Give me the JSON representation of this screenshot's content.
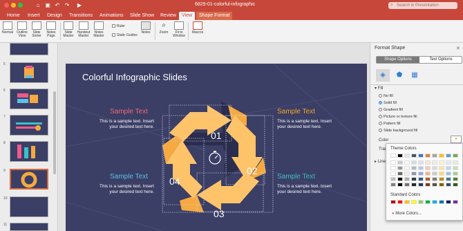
{
  "app": {
    "doc_title": "6829-01-colorful-infographic",
    "search_placeholder": "Search in Presentation"
  },
  "tabs": [
    "Home",
    "Insert",
    "Design",
    "Transitions",
    "Animations",
    "Slide Show",
    "Review",
    "View",
    "Shape Format"
  ],
  "ribbon": {
    "buttons": [
      "Normal",
      "Outline View",
      "Slide Sorter",
      "Notes Page",
      "Slide Master",
      "Handout Master",
      "Notes Master",
      "Notes",
      "Zoom",
      "Fit to Window",
      "Macros"
    ],
    "checks": [
      "Ruler",
      "Static Guides"
    ]
  },
  "thumbs": {
    "numbers": [
      "5",
      "6",
      "7",
      "8",
      "9",
      "10",
      "11"
    ]
  },
  "slide": {
    "title": "Colorful Infographic Slides",
    "numbers": [
      "01",
      "02",
      "03",
      "04"
    ],
    "items": [
      {
        "title": "Sample Text",
        "body": "This is a sample text. Insert your desired text here.",
        "color": "#f16a7a"
      },
      {
        "title": "Sample Text",
        "body": "This is a sample text. Insert your desired text here.",
        "color": "#f3a72e"
      },
      {
        "title": "Sample Text",
        "body": "This is a sample text. Insert your desired text here.",
        "color": "#5cc0e8"
      },
      {
        "title": "Sample Text",
        "body": "This is a sample text. Insert your desired text here.",
        "color": "#39c1c8"
      }
    ]
  },
  "pane": {
    "title": "Format Shape",
    "tab_shape": "Shape Options",
    "tab_text": "Text Options",
    "fill_label": "Fill",
    "options": [
      "No fill",
      "Solid fill",
      "Gradient fill",
      "Picture or texture fill",
      "Pattern fill",
      "Slide background fill"
    ],
    "selected_option": "Solid fill",
    "color_label": "Color",
    "transparency_label": "Tran",
    "line_label": "Line"
  },
  "popup": {
    "theme_label": "Theme Colors",
    "standard_label": "Standard Colors",
    "more_label": "More Colors...",
    "theme_top": [
      "#ffffff",
      "#000000",
      "#e7e6e6",
      "#44546a",
      "#4472c4",
      "#ed7d31",
      "#a5a5a5",
      "#ffc000",
      "#5b9bd5",
      "#70ad47"
    ],
    "standard": [
      "#c00000",
      "#ff0000",
      "#ffc000",
      "#ffff00",
      "#92d050",
      "#00b050",
      "#00b0f0",
      "#0070c0",
      "#002060",
      "#7030a0"
    ]
  },
  "colors": {
    "accent": "#c7473a",
    "slide_bg": "#3b3e65",
    "arrow_light": "#ffc36a",
    "arrow_dark": "#f5a940",
    "center": "#3b3e65"
  }
}
